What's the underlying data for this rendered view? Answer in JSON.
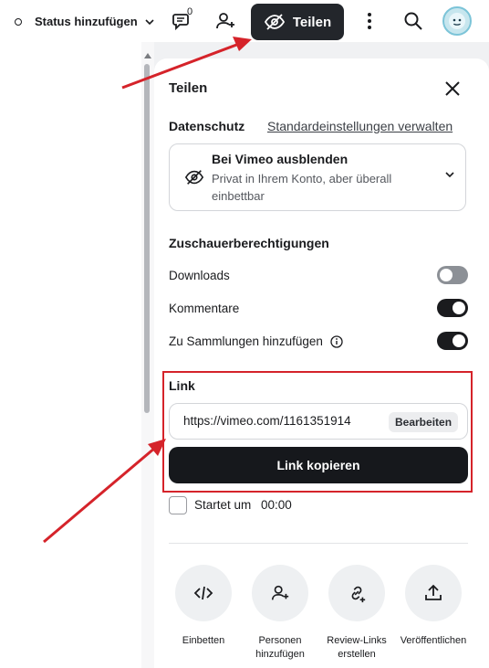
{
  "topbar": {
    "status_label": "Status hinzufügen",
    "notification_count": "0",
    "share_label": "Teilen"
  },
  "panel": {
    "title": "Teilen",
    "privacy": {
      "section_label": "Datenschutz",
      "manage_link": "Standardeinstellungen verwalten",
      "option_title": "Bei Vimeo ausblenden",
      "option_subtitle": "Privat in Ihrem Konto, aber überall einbettbar"
    },
    "permissions": {
      "section_label": "Zuschauerberechtigungen",
      "downloads_label": "Downloads",
      "downloads_enabled": false,
      "comments_label": "Kommentare",
      "comments_enabled": true,
      "collections_label": "Zu Sammlungen hinzufügen",
      "collections_enabled": true
    },
    "link": {
      "section_label": "Link",
      "url": "https://vimeo.com/1161351914",
      "edit_label": "Bearbeiten",
      "copy_label": "Link kopieren",
      "start_label": "Startet um",
      "start_time": "00:00",
      "start_checked": false
    },
    "actions": [
      {
        "label": "Einbetten",
        "icon": "code-icon"
      },
      {
        "label": "Personen hinzufügen",
        "icon": "add-person-icon"
      },
      {
        "label": "Review-Links erstellen",
        "icon": "link-add-icon"
      },
      {
        "label": "Veröffentlichen",
        "icon": "upload-icon"
      }
    ]
  },
  "colors": {
    "highlight_red": "#d5232a",
    "dark_button": "#16181c",
    "avatar_bg": "#c7e6ee"
  }
}
